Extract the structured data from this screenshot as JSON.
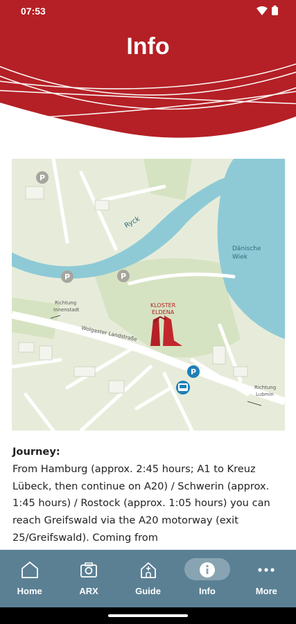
{
  "status": {
    "time": "07:53"
  },
  "header": {
    "title": "Info"
  },
  "map": {
    "labels": {
      "river": "Ryck",
      "bay_line1": "Dänische",
      "bay_line2": "Wiek",
      "monastery_line1": "KLOSTER",
      "monastery_line2": "ELDENA",
      "road": "Wolgaster Landstraße",
      "dir_left_line1": "Richtung",
      "dir_left_line2": "Innenstadt",
      "dir_right_line1": "Richtung",
      "dir_right_line2": "Lubmin",
      "parking": "P"
    }
  },
  "content": {
    "heading": "Journey:",
    "body": "From Hamburg (approx. 2:45 hours; A1 to Kreuz Lübeck, then continue on A20) / Schwerin (approx. 1:45 hours) / Rostock (approx. 1:05 hours) you can reach Greifswald via the A20 motorway (exit 25/Greifswald). Coming from"
  },
  "nav": {
    "items": [
      {
        "label": "Home",
        "icon": "home-icon"
      },
      {
        "label": "ARX",
        "icon": "camera-icon"
      },
      {
        "label": "Guide",
        "icon": "church-icon"
      },
      {
        "label": "Info",
        "icon": "info-icon"
      },
      {
        "label": "More",
        "icon": "more-icon"
      }
    ],
    "active": "Info"
  },
  "colors": {
    "header_red": "#b42025",
    "nav_bg": "#5b8094",
    "water": "#8ecad6"
  }
}
